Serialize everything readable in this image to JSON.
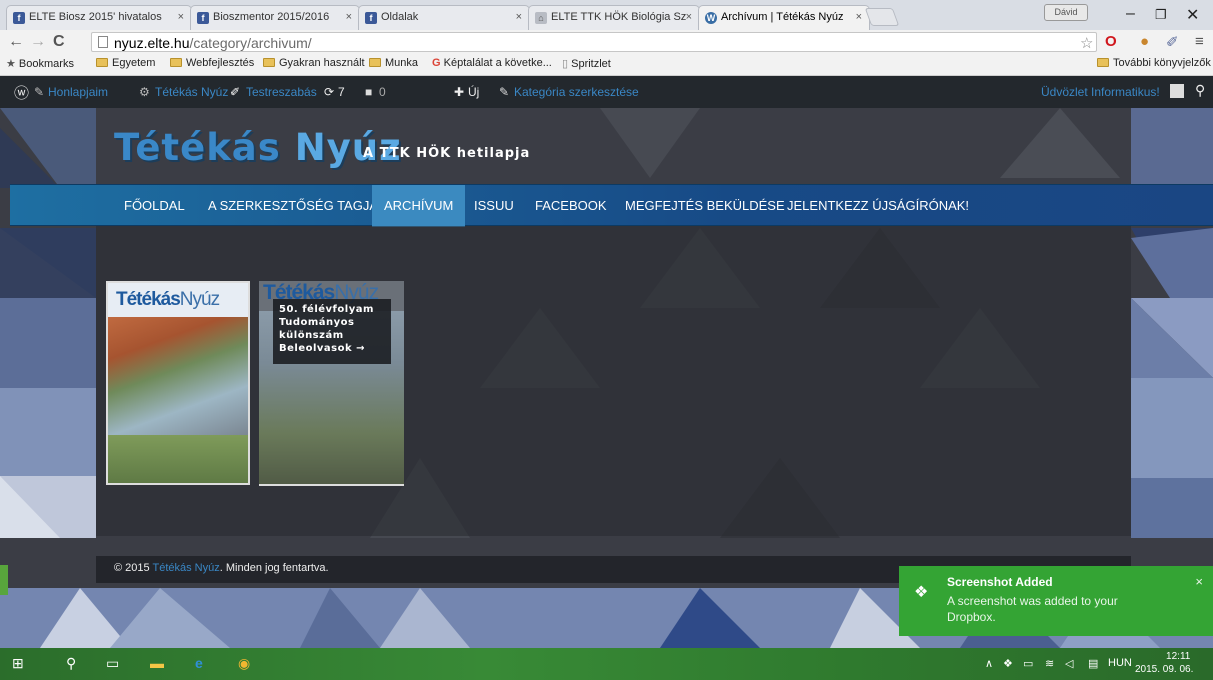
{
  "browser": {
    "tabs": [
      {
        "label": "ELTE Biosz 2015' hivatalos",
        "favicon": "facebook-favicon"
      },
      {
        "label": "Bioszmentor 2015/2016",
        "favicon": "facebook-favicon"
      },
      {
        "label": "Oldalak",
        "favicon": "facebook-favicon"
      },
      {
        "label": "ELTE TTK HÖK Biológia Sz",
        "favicon": "university-favicon"
      },
      {
        "label": "Archívum | Tétékás Nyúz",
        "favicon": "wordpress-favicon",
        "active": true
      }
    ],
    "tab_close": "×",
    "user_chip": "Dávid",
    "url_host": "nyuz.elte.hu",
    "url_path": "/category/archivum/",
    "bookmarks": [
      "Bookmarks",
      "Egyetem",
      "Webfejlesztés",
      "Gyakran használt",
      "Munka",
      "Képtalálat a követke...",
      "Spritzlet"
    ],
    "other_bookmarks": "További könyvjelzők"
  },
  "adminbar": {
    "items": [
      "Honlapjaim",
      "Tétékás Nyúz",
      "Testreszabás",
      "7",
      "0",
      "Új",
      "Kategória szerkesztése"
    ],
    "greeting": "Üdvözlet Informatikus!"
  },
  "site": {
    "logo_a": "Tétékás",
    "logo_b": "Nyúz",
    "tagline": "A TTK HÖK hetilapja",
    "nav": [
      "FŐOLDAL",
      "A SZERKESZTŐSÉG TAGJAI",
      "ARCHÍVUM",
      "ISSUU",
      "FACEBOOK",
      "MEGFEJTÉS BEKÜLDÉSE",
      "JELENTKEZZ ÚJSÁGÍRÓNAK!"
    ],
    "active_nav": "ARCHÍVUM",
    "cover_title_a": "Tétékás",
    "cover_title_b": "Nyúz",
    "overlay_lines": [
      "50. félévfolyam",
      "Tudományos",
      "különszám",
      "Beleolvasok →"
    ],
    "footer_prefix": "© 2015",
    "footer_link": "Tétékás Nyúz",
    "footer_suffix": ". Minden jog fentartva."
  },
  "toast": {
    "title": "Screenshot Added",
    "message": "A screenshot was added to your Dropbox.",
    "close": "×"
  },
  "taskbar": {
    "language": "HUN",
    "time": "12:11",
    "date": "2015. 09. 06."
  },
  "colors": {
    "accent": "#3a87c5",
    "nav_active": "#3b8ac0",
    "toast": "#34a434"
  }
}
